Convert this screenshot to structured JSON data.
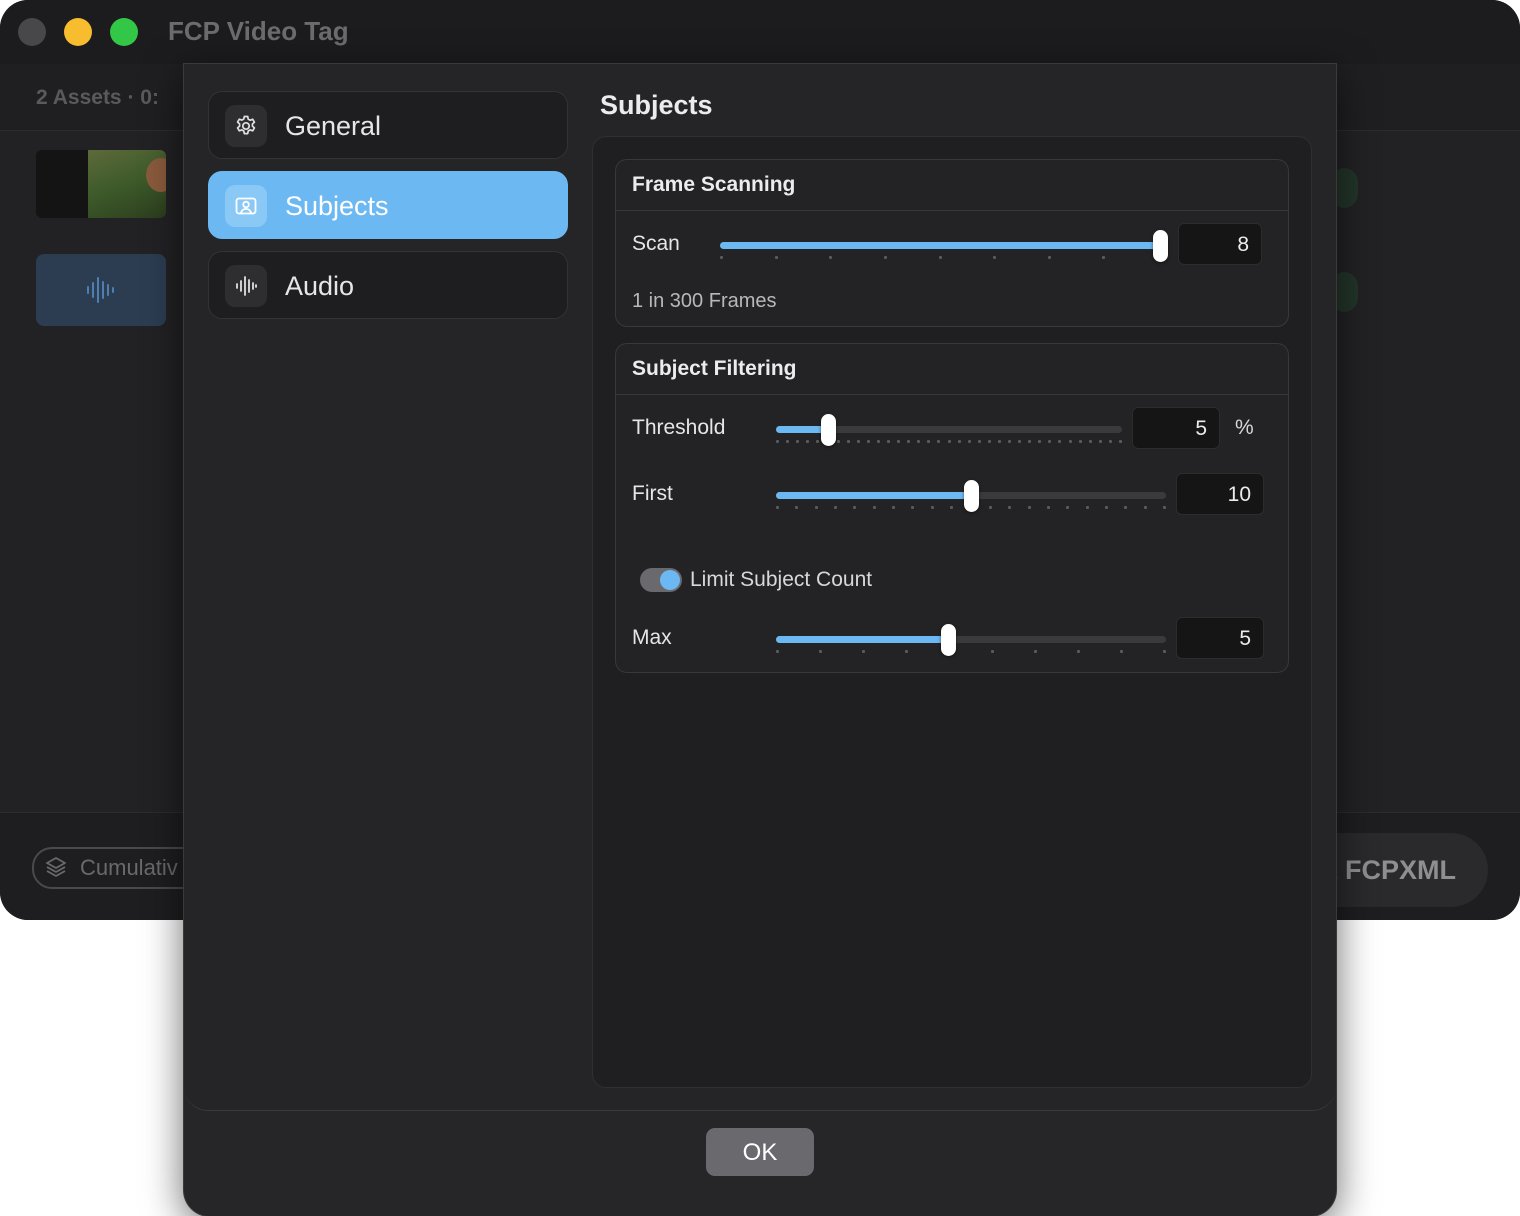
{
  "app": {
    "title": "FCP Video Tag",
    "assets_summary": "2 Assets  ·  0:",
    "cumulative_label": "Cumulativ",
    "export_label": "t FCPXML"
  },
  "icons": {
    "traffic_close": "traffic-close-icon",
    "traffic_minimize": "traffic-minimize-icon",
    "traffic_maximize": "traffic-maximize-icon",
    "general": "gear-icon",
    "subjects": "person-frame-icon",
    "audio": "waveform-icon",
    "cumulative": "layers-icon"
  },
  "colors": {
    "accent": "#6cb8f3",
    "window_bg": "#222224",
    "sheet_bg": "#262628",
    "ok_button": "#6a6a6e"
  },
  "sidebar": {
    "items": [
      {
        "label": "General",
        "selected": false
      },
      {
        "label": "Subjects",
        "selected": true
      },
      {
        "label": "Audio",
        "selected": false
      }
    ]
  },
  "main": {
    "section_title": "Subjects",
    "frame_scanning": {
      "title": "Frame Scanning",
      "scan": {
        "label": "Scan",
        "value": "8",
        "fraction": 1.0,
        "ticks": 9
      },
      "caption": "1 in 300 Frames"
    },
    "subject_filtering": {
      "title": "Subject Filtering",
      "threshold": {
        "label": "Threshold",
        "value": "5",
        "unit": "%",
        "fraction": 0.15,
        "ticks": 35
      },
      "first": {
        "label": "First",
        "value": "10",
        "fraction": 0.5,
        "ticks": 21
      },
      "limit_toggle": {
        "label": "Limit Subject Count",
        "on": true
      },
      "max": {
        "label": "Max",
        "value": "5",
        "fraction": 0.44,
        "ticks": 10
      }
    }
  },
  "footer": {
    "ok_label": "OK"
  }
}
